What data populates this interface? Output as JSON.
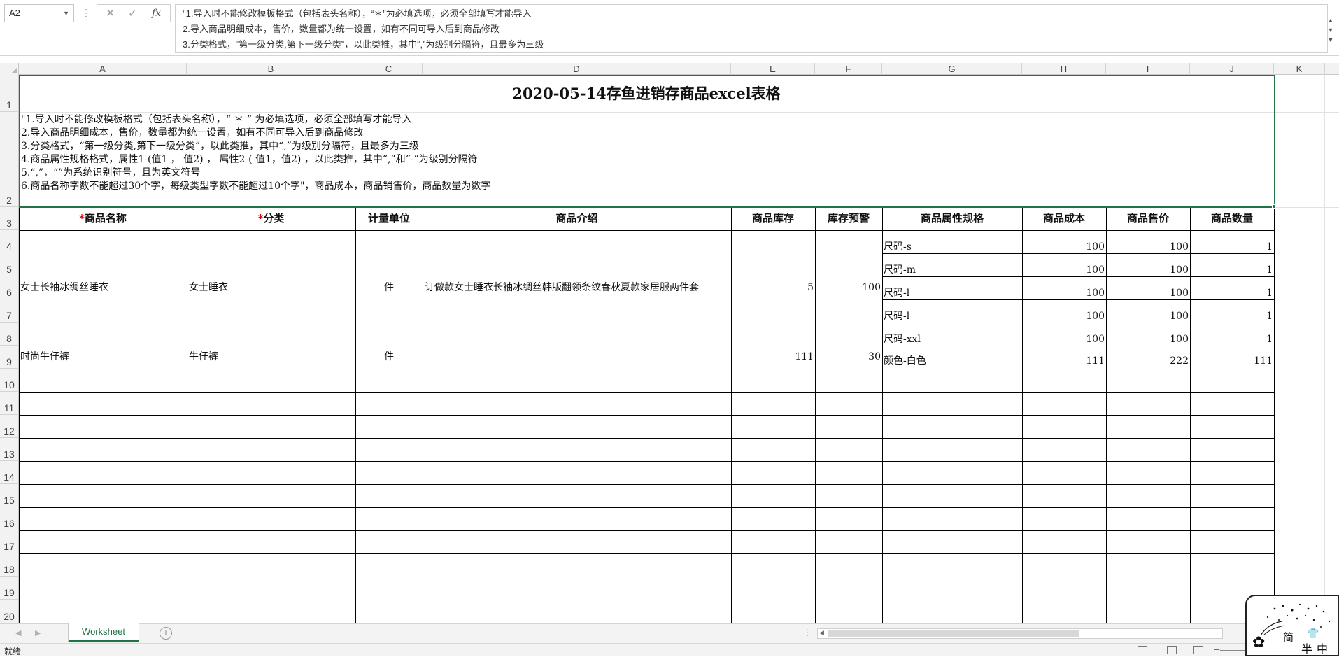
{
  "formula_bar": {
    "name_box": "A2",
    "fx_label": "fx",
    "content_lines": [
      "\"1.导入时不能修改模板格式（包括表头名称），“＊”为必填选项，必须全部填写才能导入",
      "2.导入商品明细成本，售价，数量都为统一设置，如有不同可导入后到商品修改",
      "3.分类格式，“第一级分类,第下一级分类”，以此类推，其中“,”为级别分隔符，且最多为三级"
    ]
  },
  "columns": [
    "A",
    "B",
    "C",
    "D",
    "E",
    "F",
    "G",
    "H",
    "I",
    "J",
    "K"
  ],
  "rows": [
    "1",
    "2",
    "3",
    "4",
    "5",
    "6",
    "7",
    "8",
    "9",
    "10",
    "11",
    "12",
    "13",
    "14",
    "15",
    "16",
    "17",
    "18",
    "19",
    "20"
  ],
  "sheet": {
    "title": "2020-05-14存鱼进销存商品excel表格",
    "notes": [
      "\"1.导入时不能修改模板格式（包括表头名称），“ ＊ ” 为必填选项，必须全部填写才能导入",
      "2.导入商品明细成本，售价，数量都为统一设置，如有不同可导入后到商品修改",
      "3.分类格式，“第一级分类,第下一级分类”，以此类推，其中“,”为级别分隔符，且最多为三级",
      "4.商品属性规格格式，属性1-(值1 ， 值2) ， 属性2-( 值1，值2) ，以此类推，其中“,”和“-”为级别分隔符",
      "5.“,”，“”为系统识别符号，且为英文符号",
      "6.商品名称字数不能超过30个字，每级类型字数不能超过10个字\"，商品成本，商品销售价，商品数量为数字"
    ],
    "headers": {
      "a_star": "*",
      "a": "商品名称",
      "b_star": "*",
      "b": "分类",
      "c": "计量单位",
      "d": "商品介绍",
      "e": "商品库存",
      "f": "库存预警",
      "g": "商品属性规格",
      "h": "商品成本",
      "i": "商品售价",
      "j": "商品数量"
    },
    "product1": {
      "name": "女士长袖冰绸丝睡衣",
      "category": "女士睡衣",
      "unit": "件",
      "description": "订做款女士睡衣长袖冰绸丝韩版翻领条纹春秋夏款家居服两件套",
      "stock": "5",
      "warning": "100",
      "specs": [
        {
          "spec": "尺码-s",
          "cost": "100",
          "price": "100",
          "qty": "1"
        },
        {
          "spec": "尺码-m",
          "cost": "100",
          "price": "100",
          "qty": "1"
        },
        {
          "spec": "尺码-l",
          "cost": "100",
          "price": "100",
          "qty": "1"
        },
        {
          "spec": "尺码-l",
          "cost": "100",
          "price": "100",
          "qty": "1"
        },
        {
          "spec": "尺码-xxl",
          "cost": "100",
          "price": "100",
          "qty": "1"
        }
      ]
    },
    "product2": {
      "name": "时尚牛仔裤",
      "category": "牛仔裤",
      "unit": "件",
      "stock": "111",
      "warning": "30",
      "spec": "颜色-白色",
      "cost": "111",
      "price": "222",
      "qty": "111"
    }
  },
  "tabs": {
    "sheet_name": "Worksheet",
    "add_label": "+"
  },
  "status": {
    "ready": "就绪"
  },
  "watermark": {
    "t1": "简",
    "t2": "半",
    "t3": "中"
  }
}
